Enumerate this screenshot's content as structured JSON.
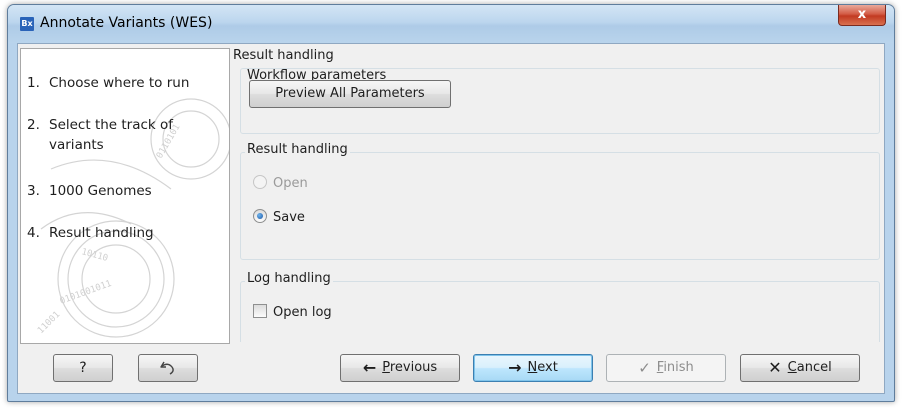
{
  "window": {
    "title": "Annotate Variants (WES)",
    "icon_text": "Bx",
    "close_label": "x"
  },
  "steps": [
    {
      "num": "1.",
      "label": "Choose where to run"
    },
    {
      "num": "2.",
      "label": "Select the track of variants"
    },
    {
      "num": "3.",
      "label": "1000 Genomes"
    },
    {
      "num": "4.",
      "label": "Result handling"
    }
  ],
  "main": {
    "section_title": "Result handling",
    "workflow_params": {
      "label": "Workflow parameters",
      "button": "Preview All Parameters"
    },
    "result_handling": {
      "label": "Result handling",
      "options": [
        {
          "label": "Open",
          "selected": false,
          "enabled": false
        },
        {
          "label": "Save",
          "selected": true,
          "enabled": true
        }
      ]
    },
    "log_handling": {
      "label": "Log handling",
      "checkbox_label": "Open log",
      "checked": false
    }
  },
  "footer": {
    "help_label": "?",
    "reset_icon": "undo-arrow-icon",
    "previous": {
      "first": "P",
      "rest": "revious",
      "icon": "arrow-left-icon"
    },
    "next": {
      "first": "N",
      "rest": "ext",
      "icon": "arrow-right-icon"
    },
    "finish": {
      "first": "F",
      "rest": "inish",
      "icon": "checkmark-icon"
    },
    "cancel": {
      "first": "C",
      "rest": "ancel",
      "icon": "x-icon"
    }
  },
  "colors": {
    "title_bar": "#b9d4ec",
    "close_button": "#c23a21",
    "focus_button": "#bee6fd",
    "radio_dot": "#1a57a6"
  }
}
